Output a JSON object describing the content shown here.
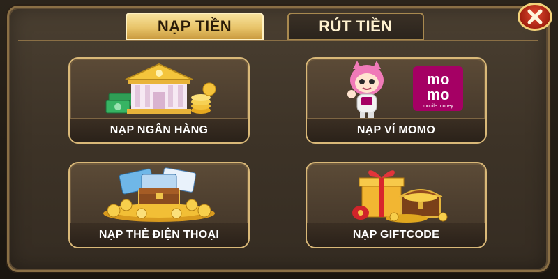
{
  "tabs": {
    "deposit_label": "NẠP TIỀN",
    "withdraw_label": "RÚT TIỀN"
  },
  "close_icon": "close-icon",
  "options": {
    "bank": {
      "label": "NẠP NGÂN HÀNG",
      "icon": "bank-icon"
    },
    "momo": {
      "label": "NẠP VÍ MOMO",
      "icon": "momo-wallet-icon",
      "logo_text_top": "mo",
      "logo_text_bottom": "mo",
      "logo_caption": "mobile money"
    },
    "phone_card": {
      "label": "NẠP THẺ ĐIỆN THOẠI",
      "icon": "phone-card-treasure-icon"
    },
    "giftcode": {
      "label": "NẠP GIFTCODE",
      "icon": "gift-box-icon"
    }
  },
  "colors": {
    "accent_gold": "#e8c469",
    "momo_pink": "#a50064",
    "close_red": "#c0301a"
  }
}
